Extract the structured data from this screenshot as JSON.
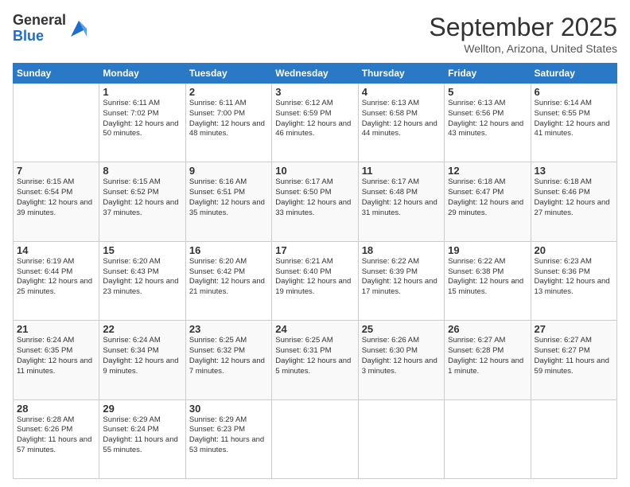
{
  "header": {
    "logo_general": "General",
    "logo_blue": "Blue",
    "month_title": "September 2025",
    "location": "Wellton, Arizona, United States"
  },
  "weekdays": [
    "Sunday",
    "Monday",
    "Tuesday",
    "Wednesday",
    "Thursday",
    "Friday",
    "Saturday"
  ],
  "weeks": [
    [
      {
        "day": "",
        "sunrise": "",
        "sunset": "",
        "daylight": ""
      },
      {
        "day": "1",
        "sunrise": "Sunrise: 6:11 AM",
        "sunset": "Sunset: 7:02 PM",
        "daylight": "Daylight: 12 hours and 50 minutes."
      },
      {
        "day": "2",
        "sunrise": "Sunrise: 6:11 AM",
        "sunset": "Sunset: 7:00 PM",
        "daylight": "Daylight: 12 hours and 48 minutes."
      },
      {
        "day": "3",
        "sunrise": "Sunrise: 6:12 AM",
        "sunset": "Sunset: 6:59 PM",
        "daylight": "Daylight: 12 hours and 46 minutes."
      },
      {
        "day": "4",
        "sunrise": "Sunrise: 6:13 AM",
        "sunset": "Sunset: 6:58 PM",
        "daylight": "Daylight: 12 hours and 44 minutes."
      },
      {
        "day": "5",
        "sunrise": "Sunrise: 6:13 AM",
        "sunset": "Sunset: 6:56 PM",
        "daylight": "Daylight: 12 hours and 43 minutes."
      },
      {
        "day": "6",
        "sunrise": "Sunrise: 6:14 AM",
        "sunset": "Sunset: 6:55 PM",
        "daylight": "Daylight: 12 hours and 41 minutes."
      }
    ],
    [
      {
        "day": "7",
        "sunrise": "Sunrise: 6:15 AM",
        "sunset": "Sunset: 6:54 PM",
        "daylight": "Daylight: 12 hours and 39 minutes."
      },
      {
        "day": "8",
        "sunrise": "Sunrise: 6:15 AM",
        "sunset": "Sunset: 6:52 PM",
        "daylight": "Daylight: 12 hours and 37 minutes."
      },
      {
        "day": "9",
        "sunrise": "Sunrise: 6:16 AM",
        "sunset": "Sunset: 6:51 PM",
        "daylight": "Daylight: 12 hours and 35 minutes."
      },
      {
        "day": "10",
        "sunrise": "Sunrise: 6:17 AM",
        "sunset": "Sunset: 6:50 PM",
        "daylight": "Daylight: 12 hours and 33 minutes."
      },
      {
        "day": "11",
        "sunrise": "Sunrise: 6:17 AM",
        "sunset": "Sunset: 6:48 PM",
        "daylight": "Daylight: 12 hours and 31 minutes."
      },
      {
        "day": "12",
        "sunrise": "Sunrise: 6:18 AM",
        "sunset": "Sunset: 6:47 PM",
        "daylight": "Daylight: 12 hours and 29 minutes."
      },
      {
        "day": "13",
        "sunrise": "Sunrise: 6:18 AM",
        "sunset": "Sunset: 6:46 PM",
        "daylight": "Daylight: 12 hours and 27 minutes."
      }
    ],
    [
      {
        "day": "14",
        "sunrise": "Sunrise: 6:19 AM",
        "sunset": "Sunset: 6:44 PM",
        "daylight": "Daylight: 12 hours and 25 minutes."
      },
      {
        "day": "15",
        "sunrise": "Sunrise: 6:20 AM",
        "sunset": "Sunset: 6:43 PM",
        "daylight": "Daylight: 12 hours and 23 minutes."
      },
      {
        "day": "16",
        "sunrise": "Sunrise: 6:20 AM",
        "sunset": "Sunset: 6:42 PM",
        "daylight": "Daylight: 12 hours and 21 minutes."
      },
      {
        "day": "17",
        "sunrise": "Sunrise: 6:21 AM",
        "sunset": "Sunset: 6:40 PM",
        "daylight": "Daylight: 12 hours and 19 minutes."
      },
      {
        "day": "18",
        "sunrise": "Sunrise: 6:22 AM",
        "sunset": "Sunset: 6:39 PM",
        "daylight": "Daylight: 12 hours and 17 minutes."
      },
      {
        "day": "19",
        "sunrise": "Sunrise: 6:22 AM",
        "sunset": "Sunset: 6:38 PM",
        "daylight": "Daylight: 12 hours and 15 minutes."
      },
      {
        "day": "20",
        "sunrise": "Sunrise: 6:23 AM",
        "sunset": "Sunset: 6:36 PM",
        "daylight": "Daylight: 12 hours and 13 minutes."
      }
    ],
    [
      {
        "day": "21",
        "sunrise": "Sunrise: 6:24 AM",
        "sunset": "Sunset: 6:35 PM",
        "daylight": "Daylight: 12 hours and 11 minutes."
      },
      {
        "day": "22",
        "sunrise": "Sunrise: 6:24 AM",
        "sunset": "Sunset: 6:34 PM",
        "daylight": "Daylight: 12 hours and 9 minutes."
      },
      {
        "day": "23",
        "sunrise": "Sunrise: 6:25 AM",
        "sunset": "Sunset: 6:32 PM",
        "daylight": "Daylight: 12 hours and 7 minutes."
      },
      {
        "day": "24",
        "sunrise": "Sunrise: 6:25 AM",
        "sunset": "Sunset: 6:31 PM",
        "daylight": "Daylight: 12 hours and 5 minutes."
      },
      {
        "day": "25",
        "sunrise": "Sunrise: 6:26 AM",
        "sunset": "Sunset: 6:30 PM",
        "daylight": "Daylight: 12 hours and 3 minutes."
      },
      {
        "day": "26",
        "sunrise": "Sunrise: 6:27 AM",
        "sunset": "Sunset: 6:28 PM",
        "daylight": "Daylight: 12 hours and 1 minute."
      },
      {
        "day": "27",
        "sunrise": "Sunrise: 6:27 AM",
        "sunset": "Sunset: 6:27 PM",
        "daylight": "Daylight: 11 hours and 59 minutes."
      }
    ],
    [
      {
        "day": "28",
        "sunrise": "Sunrise: 6:28 AM",
        "sunset": "Sunset: 6:26 PM",
        "daylight": "Daylight: 11 hours and 57 minutes."
      },
      {
        "day": "29",
        "sunrise": "Sunrise: 6:29 AM",
        "sunset": "Sunset: 6:24 PM",
        "daylight": "Daylight: 11 hours and 55 minutes."
      },
      {
        "day": "30",
        "sunrise": "Sunrise: 6:29 AM",
        "sunset": "Sunset: 6:23 PM",
        "daylight": "Daylight: 11 hours and 53 minutes."
      },
      {
        "day": "",
        "sunrise": "",
        "sunset": "",
        "daylight": ""
      },
      {
        "day": "",
        "sunrise": "",
        "sunset": "",
        "daylight": ""
      },
      {
        "day": "",
        "sunrise": "",
        "sunset": "",
        "daylight": ""
      },
      {
        "day": "",
        "sunrise": "",
        "sunset": "",
        "daylight": ""
      }
    ]
  ]
}
